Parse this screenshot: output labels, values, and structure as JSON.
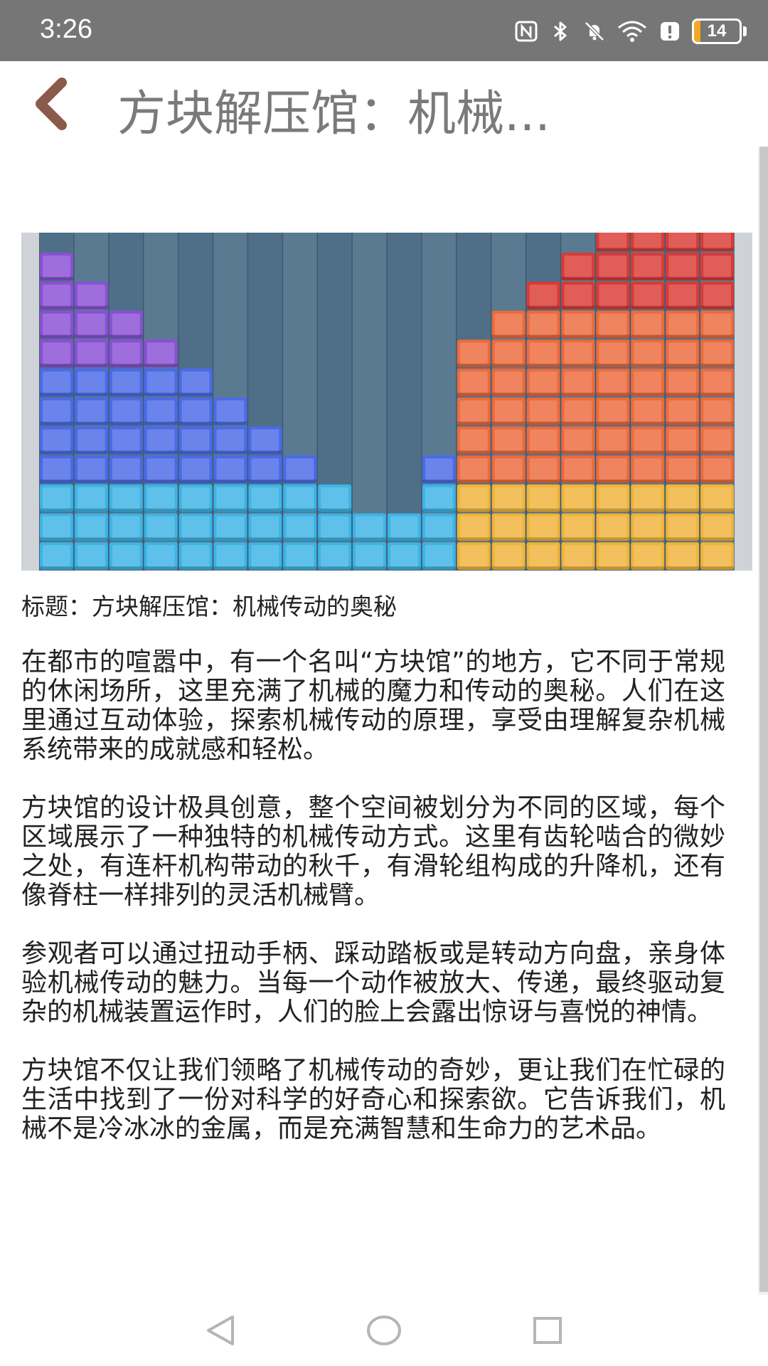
{
  "status_bar": {
    "time": "3:26",
    "battery_level": "14",
    "battery_fraction": 0.14,
    "icons": [
      "nfc-icon",
      "bluetooth-icon",
      "mute-icon",
      "wifi-icon",
      "alert-icon",
      "battery-icon"
    ],
    "battery_color": "#f5a623"
  },
  "app_bar": {
    "back_icon": "chevron-left-icon",
    "back_color": "#8a5a4a",
    "title": "方块解压馆：机械..."
  },
  "article": {
    "image_description_icon": "block-puzzle-image",
    "heading": "标题：方块解压馆：机械传动的奥秘",
    "paragraphs": [
      "在都市的喧嚣中，有一个名叫“方块馆”的地方，它不同于常规的休闲场所，这里充满了机械的魔力和传动的奥秘。人们在这里通过互动体验，探索机械传动的原理，享受由理解复杂机械系统带来的成就感和轻松。",
      "方块馆的设计极具创意，整个空间被划分为不同的区域，每个区域展示了一种独特的机械传动方式。这里有齿轮啮合的微妙之处，有连杆机构带动的秋千，有滑轮组构成的升降机，还有像脊柱一样排列的灵活机械臂。",
      "参观者可以通过扭动手柄、踩动踏板或是转动方向盘，亲身体验机械传动的魅力。当每一个动作被放大、传递，最终驱动复杂的机械装置运作时，人们的脸上会露出惊讶与喜悦的神情。",
      "方块馆不仅让我们领略了机械传动的奇妙，更让我们在忙碌的生活中找到了一份对科学的好奇心和探索欲。它告诉我们，机械不是冷冰冰的金属，而是充满智慧和生命力的艺术品。"
    ]
  },
  "nav_bar": {
    "buttons": [
      "back-triangle-icon",
      "home-circle-icon",
      "recents-square-icon"
    ]
  },
  "block_colors": {
    "purple": "#8a4fd6",
    "blue": "#4a6ae8",
    "cyan": "#3cb4e6",
    "red": "#d93a34",
    "orange": "#ec6a3c",
    "yellow": "#f0b43a",
    "background": "#4f6f88"
  }
}
